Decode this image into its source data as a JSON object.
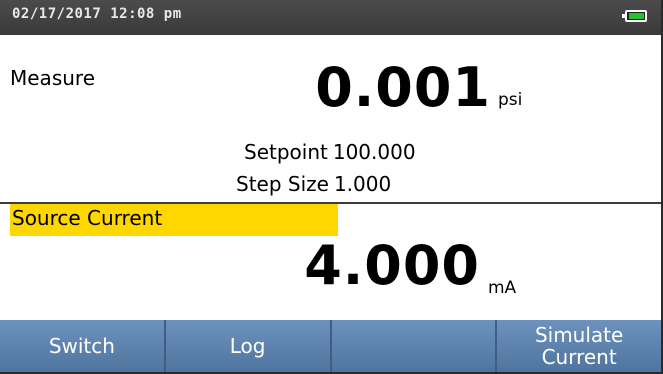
{
  "status": {
    "datetime": "02/17/2017 12:08 pm",
    "battery_icon": "battery-icon"
  },
  "measure": {
    "label": "Measure",
    "value": "0.001",
    "unit": "psi",
    "setpoint_label": "Setpoint",
    "setpoint_value": "100.000",
    "stepsize_label": "Step Size",
    "stepsize_value": "1.000"
  },
  "source": {
    "label": "Source Current",
    "value": "4.000",
    "unit": "mA",
    "highlight_color": "#ffd700"
  },
  "softkeys": [
    {
      "label": "Switch"
    },
    {
      "label": "Log"
    },
    {
      "label": ""
    },
    {
      "label": "Simulate\nCurrent"
    }
  ],
  "colors": {
    "status_bar": "#3f3f3f",
    "softkey_bg": "#5c81ad",
    "battery_fill": "#22c42a"
  }
}
